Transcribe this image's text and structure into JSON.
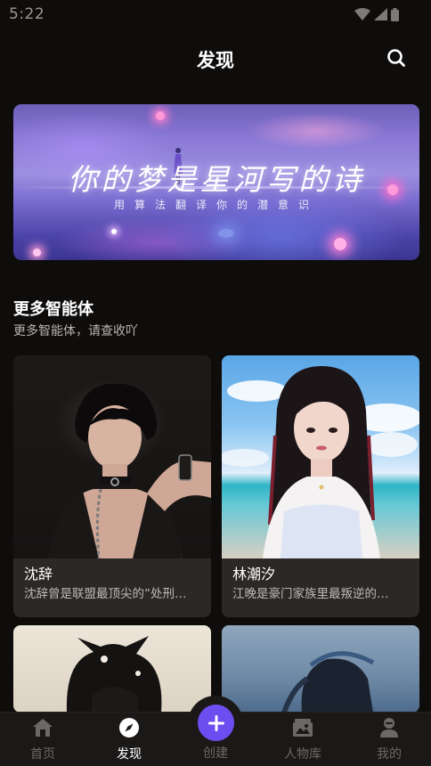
{
  "status_bar": {
    "time": "5:22"
  },
  "header": {
    "title": "发现",
    "search_icon": "search-icon"
  },
  "banner": {
    "title": "你的梦是星河写的诗",
    "subtitle": "用算法翻译你的潜意识"
  },
  "section": {
    "title": "更多智能体",
    "subtitle": "更多智能体，请查收吖"
  },
  "cards": [
    {
      "name": "沈辞",
      "desc": "沈辞曾是联盟最顶尖的”处刑…"
    },
    {
      "name": "林潮汐",
      "desc": "江晚是豪门家族里最叛逆的…"
    },
    {
      "name": "",
      "desc": ""
    },
    {
      "name": "",
      "desc": ""
    }
  ],
  "bottom_nav": {
    "items": [
      {
        "label": "首页",
        "icon": "home-icon"
      },
      {
        "label": "发现",
        "icon": "compass-icon"
      },
      {
        "label": "创建",
        "icon": "plus-icon"
      },
      {
        "label": "人物库",
        "icon": "gallery-icon"
      },
      {
        "label": "我的",
        "icon": "profile-icon"
      }
    ],
    "active": "发现"
  },
  "colors": {
    "background": "#0f0d0c",
    "card": "#2b2826",
    "accent": "#6c4ef0",
    "nav_bar": "#1b1918"
  }
}
